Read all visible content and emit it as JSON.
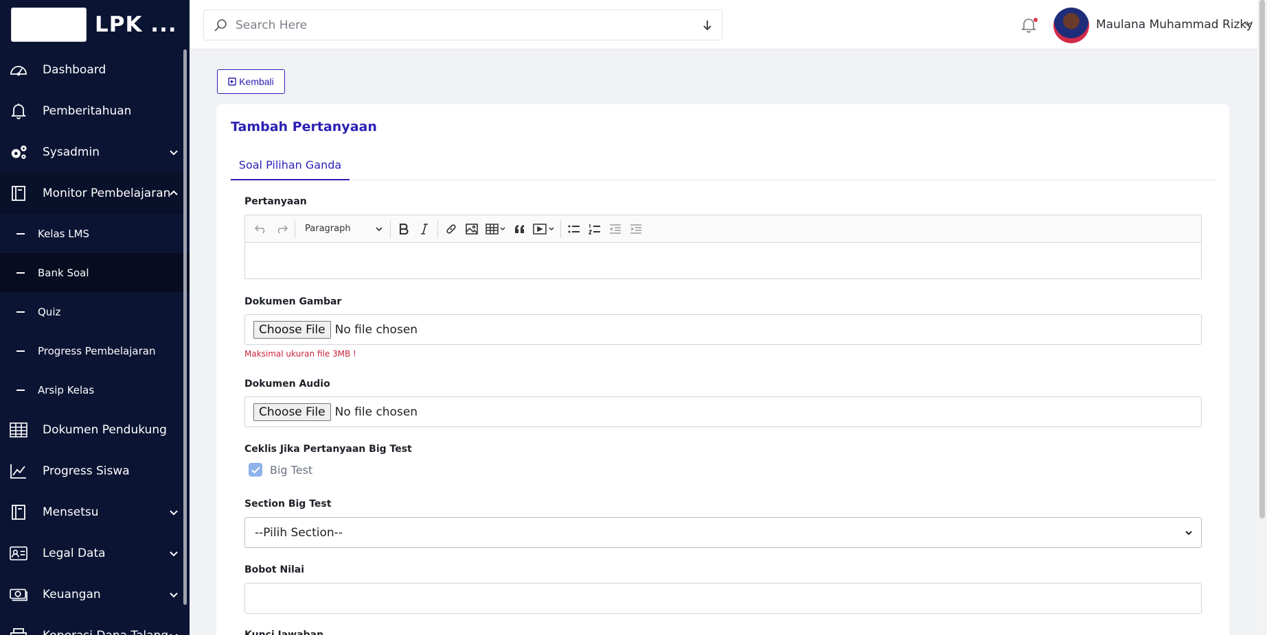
{
  "brand": {
    "title": "LPK ..."
  },
  "sidebar": {
    "items": [
      {
        "label": "Dashboard",
        "icon": "dashboard-gauge-icon"
      },
      {
        "label": "Pemberitahuan",
        "icon": "bell-icon"
      },
      {
        "label": "Sysadmin",
        "icon": "gears-icon",
        "expandable": true
      },
      {
        "label": "Monitor Pembelajaran",
        "icon": "book-icon",
        "expandable": true,
        "expanded": true
      },
      {
        "label": "Dokumen Pendukung",
        "icon": "table-icon"
      },
      {
        "label": "Progress Siswa",
        "icon": "chart-line-icon"
      },
      {
        "label": "Mensetsu",
        "icon": "book-icon",
        "expandable": true
      },
      {
        "label": "Legal Data",
        "icon": "id-card-icon",
        "expandable": true
      },
      {
        "label": "Keuangan",
        "icon": "money-icon",
        "expandable": true
      },
      {
        "label": "Koperasi Dana Talang",
        "icon": "cash-register-icon",
        "expandable": true
      }
    ],
    "subitems": [
      {
        "label": "Kelas LMS"
      },
      {
        "label": "Bank Soal",
        "active": true
      },
      {
        "label": "Quiz"
      },
      {
        "label": "Progress Pembelajaran"
      },
      {
        "label": "Arsip Kelas"
      }
    ]
  },
  "search": {
    "placeholder": "Search Here"
  },
  "user": {
    "name": "Maulana Muhammad Rizky"
  },
  "back_button": {
    "label": "Kembali"
  },
  "form": {
    "title": "Tambah Pertanyaan",
    "tab": "Soal Pilihan Ganda",
    "question_label": "Pertanyaan",
    "editor": {
      "paragraph_format": "Paragraph"
    },
    "image_label": "Dokumen Gambar",
    "image_file_button": "Choose File",
    "image_file_status": "No file chosen",
    "image_hint": "Maksimal ukuran file 3MB !",
    "audio_label": "Dokumen Audio",
    "audio_file_button": "Choose File",
    "audio_file_status": "No file chosen",
    "bigtest_label": "Ceklis Jika Pertanyaan Big Test",
    "bigtest_checkbox_label": "Big Test",
    "bigtest_checked": true,
    "section_label": "Section Big Test",
    "section_selected": "--Pilih Section--",
    "weight_label": "Bobot Nilai",
    "weight_value": "",
    "answer_label": "Kunci Jawaban"
  },
  "colors": {
    "sidebar_bg": "#0b1433",
    "accent": "#2c1fb3",
    "hint_red": "#c8243a"
  }
}
